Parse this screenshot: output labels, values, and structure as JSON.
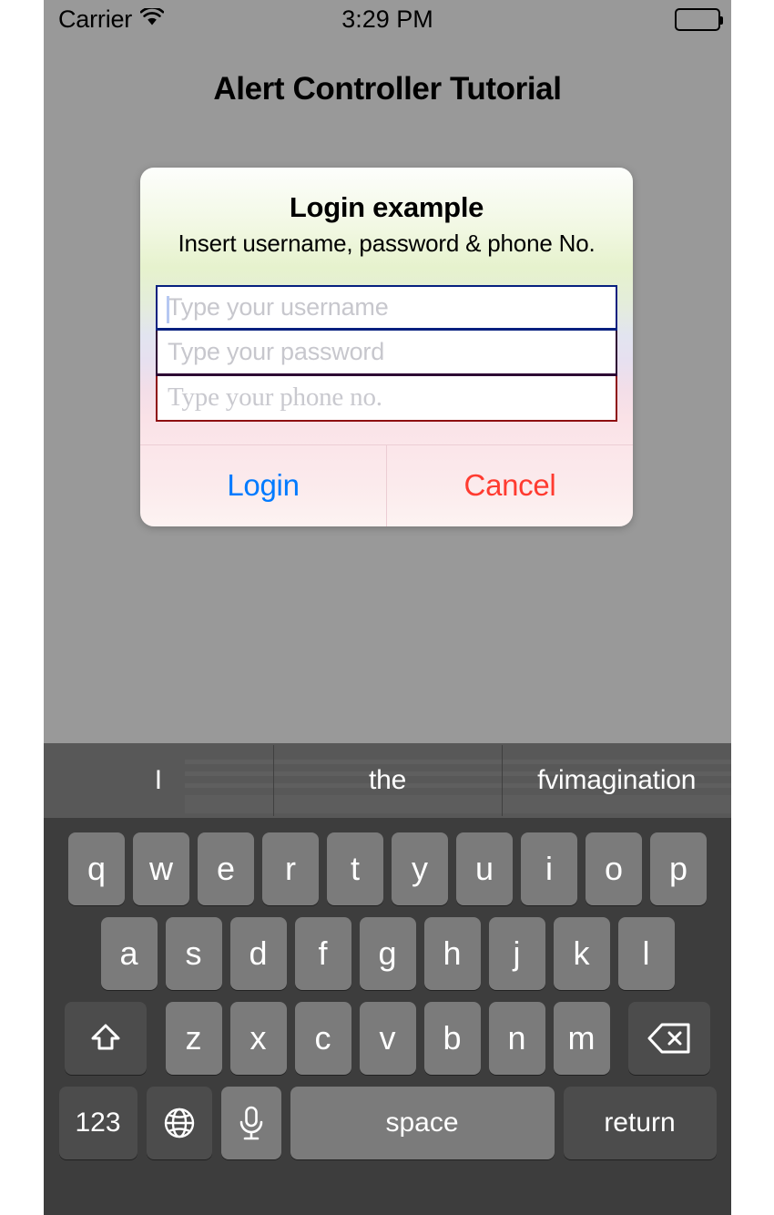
{
  "status_bar": {
    "carrier": "Carrier",
    "wifi_icon": "wifi-icon",
    "time": "3:29 PM",
    "battery_icon": "battery-full-icon"
  },
  "app": {
    "title": "Alert Controller Tutorial",
    "background_color": "#999999"
  },
  "alert": {
    "title": "Login example",
    "message": "Insert username, password & phone No.",
    "fields": [
      {
        "name": "username",
        "placeholder": "Type your username",
        "value": "",
        "border_color": "#06207f",
        "focused": true
      },
      {
        "name": "password",
        "placeholder": "Type your password",
        "value": "",
        "border_color": "#2d0033",
        "focused": false
      },
      {
        "name": "phone",
        "placeholder": "Type your phone no.",
        "value": "",
        "border_color": "#8e0d10",
        "focused": false
      }
    ],
    "actions": [
      {
        "label": "Login",
        "color": "#007aff"
      },
      {
        "label": "Cancel",
        "color": "#ff3b30"
      }
    ]
  },
  "keyboard": {
    "suggestions": [
      "I",
      "the",
      "fvimagination"
    ],
    "row1": [
      "q",
      "w",
      "e",
      "r",
      "t",
      "y",
      "u",
      "i",
      "o",
      "p"
    ],
    "row2": [
      "a",
      "s",
      "d",
      "f",
      "g",
      "h",
      "j",
      "k",
      "l"
    ],
    "row3": [
      "z",
      "x",
      "c",
      "v",
      "b",
      "n",
      "m"
    ],
    "shift_icon": "shift-arrow-icon",
    "backspace_icon": "backspace-delete-icon",
    "numbers_label": "123",
    "globe_icon": "globe-icon",
    "mic_icon": "microphone-icon",
    "space_label": "space",
    "return_label": "return"
  }
}
